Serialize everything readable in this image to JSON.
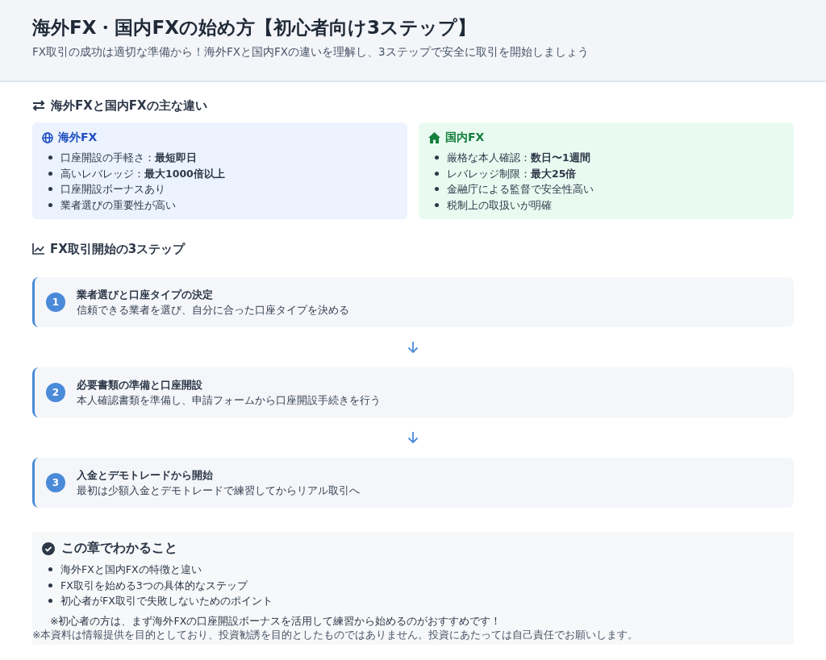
{
  "header": {
    "title": "海外FX・国内FXの始め方【初心者向け3ステップ】",
    "subtitle": "FX取引の成功は適切な準備から！海外FXと国内FXの違いを理解し、3ステップで安全に取引を開始しましょう"
  },
  "comparison": {
    "heading": "海外FXと国内FXの主な違い",
    "cards": [
      {
        "kind": "overseas",
        "title": "海外FX",
        "points": [
          "口座開設の手軽さ：**最短即日**",
          "高いレバレッジ：**最大1000倍以上**",
          "口座開設ボーナスあり",
          "業者選びの重要性が高い"
        ]
      },
      {
        "kind": "domestic",
        "title": "国内FX",
        "points": [
          "厳格な本人確認：**数日〜1週間**",
          "レバレッジ制限：**最大25倍**",
          "金融庁による監督で安全性高い",
          "税制上の取扱いが明確"
        ]
      }
    ]
  },
  "steps": {
    "heading": "FX取引開始の3ステップ",
    "items": [
      {
        "number": "1",
        "title": "業者選びと口座タイプの決定",
        "description": "信頼できる業者を選び、自分に合った口座タイプを決める"
      },
      {
        "number": "2",
        "title": "必要書類の準備と口座開設",
        "description": "本人確認書類を準備し、申請フォームから口座開設手続きを行う"
      },
      {
        "number": "3",
        "title": "入金とデモトレードから開始",
        "description": "最初は少額入金とデモトレードで練習してからリアル取引へ"
      }
    ]
  },
  "summary": {
    "heading": "この章でわかること",
    "points": [
      "海外FXと国内FXの特徴と違い",
      "FX取引を始める3つの具体的なステップ",
      "初心者がFX取引で失敗しないためのポイント"
    ],
    "note": "※初心者の方は、まず海外FXの口座開設ボーナスを活用して練習から始めるのがおすすめです！",
    "disclaimer": "※本資料は情報提供を目的としており、投資勧誘を目的としたものではありません。投資にあたっては自己責任でお願いします。"
  }
}
